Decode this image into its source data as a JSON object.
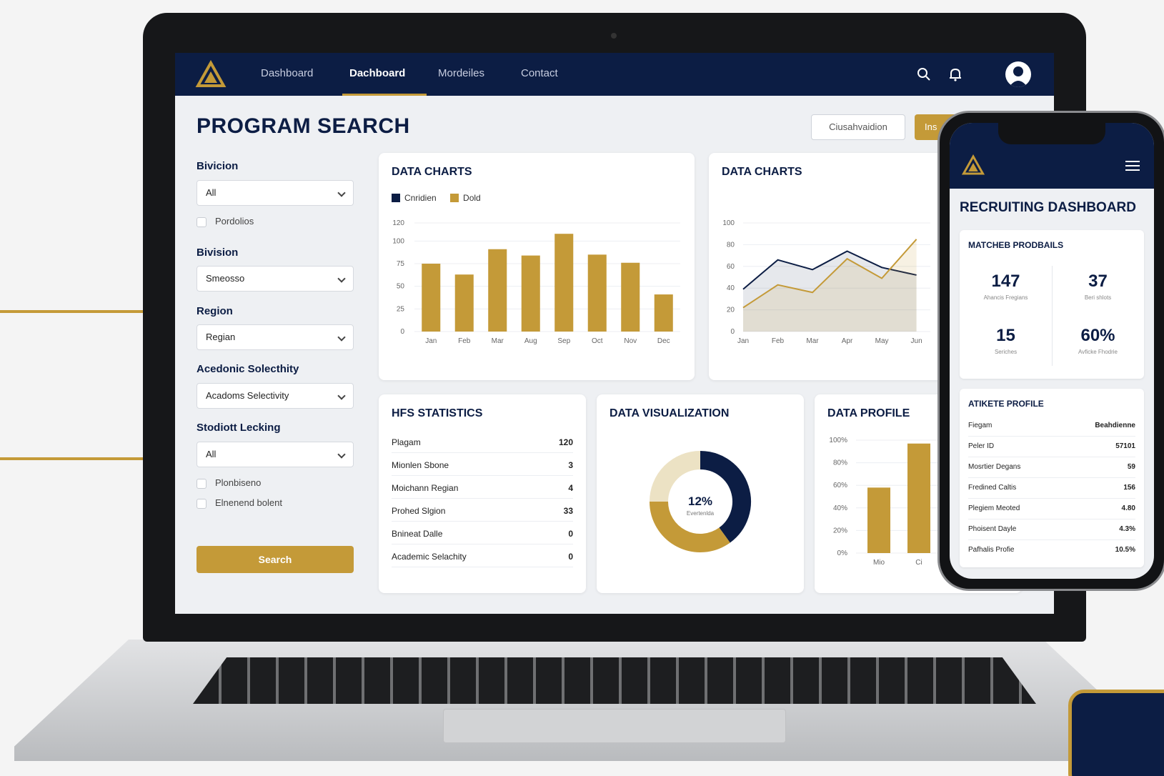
{
  "colors": {
    "navy": "#0c1d44",
    "gold": "#c49a38",
    "background": "#eef0f3"
  },
  "laptop": {
    "nav": {
      "logo_icon": "triangle-logo-icon",
      "items": [
        {
          "label": "Dashboard",
          "active": false
        },
        {
          "label": "Dachboard",
          "active": true
        },
        {
          "label": "Mordeiles",
          "active": false
        },
        {
          "label": "Contact",
          "active": false
        }
      ],
      "icons": [
        "search-icon",
        "bell-icon",
        "user-avatar"
      ]
    },
    "page_title": "PROGRAM SEARCH",
    "top_button": "Ciusahvaidion",
    "top_button_gold": "Ins",
    "filters": {
      "division1": {
        "label": "Bivicion",
        "value": "All",
        "checkbox": "Pordolios"
      },
      "division2": {
        "label": "Bivision",
        "value": "Smeosso"
      },
      "region": {
        "label": "Region",
        "value": "Regian"
      },
      "academic": {
        "label": "Acedonic Solecthity",
        "value": "Acadoms Selectivity"
      },
      "student": {
        "label": "Stodiott Lecking",
        "value": "All",
        "checkbox1": "Plonbiseno",
        "checkbox2": "Elnenend bolent"
      },
      "search_button": "Search"
    },
    "bar_card": {
      "title": "DATA CHARTS",
      "legend": [
        "Cnridien",
        "Dold"
      ]
    },
    "line_card": {
      "title": "DATA CHARTS"
    },
    "stats_card": {
      "title": "HFS STATISTICS",
      "rows": [
        {
          "label": "Plagam",
          "value": "120"
        },
        {
          "label": "Mionlen Sbone",
          "value": "3"
        },
        {
          "label": "Moichann Regian",
          "value": "4"
        },
        {
          "label": "Prohed Slgion",
          "value": "33"
        },
        {
          "label": "Bnineat Dalle",
          "value": "0"
        },
        {
          "label": "Academic Selachity",
          "value": "0"
        }
      ]
    },
    "donut_card": {
      "title": "DATA VISUALIZATION",
      "value": "12%",
      "caption": "Evertenlda"
    },
    "profile_card": {
      "title": "DATA PROFILE"
    }
  },
  "phone": {
    "menu_icon": "hamburger-menu-icon",
    "title": "RECRUITING DASHBOARD",
    "matched": {
      "title": "MATCHEB PRODBAILS",
      "metrics": [
        {
          "value": "147",
          "caption": "Ahancis Fregians"
        },
        {
          "value": "37",
          "caption": "Beri shlots"
        },
        {
          "value": "15",
          "caption": "Seriches"
        },
        {
          "value": "60%",
          "caption": "Avficke Fhodrie"
        }
      ]
    },
    "profile": {
      "title": "ATIKETE PROFILE",
      "rows": [
        {
          "label": "Fiegam",
          "value": "Beahdienne"
        },
        {
          "label": "Peler ID",
          "value": "57101"
        },
        {
          "label": "Mosrtier Degans",
          "value": "59"
        },
        {
          "label": "Fredined Caltis",
          "value": "156"
        },
        {
          "label": "Plegiem Meoted",
          "value": "4.80"
        },
        {
          "label": "Phoisent Dayle",
          "value": "4.3%"
        },
        {
          "label": "Pafhalis Profie",
          "value": "10.5%"
        }
      ]
    }
  },
  "chart_data": [
    {
      "type": "bar",
      "title": "DATA CHARTS",
      "categories": [
        "Jan",
        "Feb",
        "Mar",
        "Aug",
        "Sep",
        "Oct",
        "Nov",
        "Dec"
      ],
      "series": [
        {
          "name": "Dold",
          "values": [
            75,
            63,
            91,
            84,
            108,
            85,
            76,
            41
          ]
        }
      ],
      "yticks": [
        "0",
        "25",
        "50",
        "75",
        "100",
        "120"
      ],
      "ylim": [
        0,
        120
      ],
      "color": "#c49a38"
    },
    {
      "type": "line",
      "title": "DATA CHARTS",
      "categories": [
        "Jan",
        "Feb",
        "Mar",
        "Apr",
        "May",
        "Jun"
      ],
      "series": [
        {
          "values": [
            39,
            66,
            57,
            74,
            59,
            52
          ]
        },
        {
          "values": [
            22,
            43,
            36,
            67,
            49,
            85
          ]
        }
      ],
      "yticks": [
        "0",
        "20",
        "40",
        "60",
        "80",
        "100"
      ],
      "ylim": [
        0,
        100
      ],
      "colors": [
        "#0c1d44",
        "#c49a38"
      ]
    },
    {
      "type": "pie",
      "title": "DATA VISUALIZATION",
      "center_label": "12%",
      "slices": [
        {
          "value": 40,
          "color": "#0c1d44"
        },
        {
          "value": 35,
          "color": "#c49a38"
        },
        {
          "value": 25,
          "color": "#ece2c4"
        }
      ]
    },
    {
      "type": "bar",
      "title": "DATA PROFILE",
      "categories": [
        "Mio",
        "Ci"
      ],
      "values": [
        58,
        97
      ],
      "yticks": [
        "0%",
        "20%",
        "40%",
        "60%",
        "80%",
        "100%"
      ],
      "ylim": [
        0,
        100
      ]
    }
  ]
}
